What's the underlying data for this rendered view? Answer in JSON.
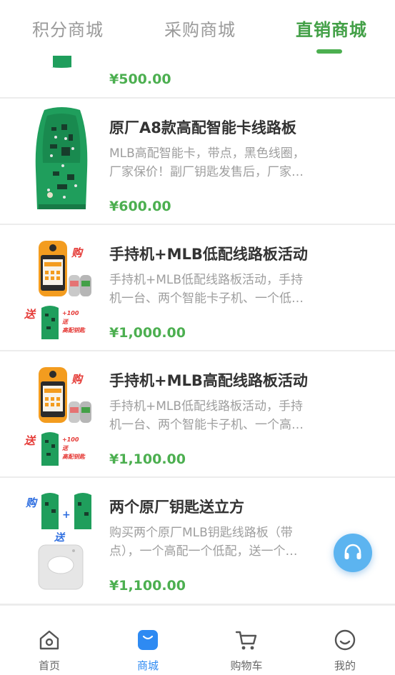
{
  "tabs": [
    {
      "label": "积分商城"
    },
    {
      "label": "采购商城"
    },
    {
      "label": "直销商城",
      "active": true
    }
  ],
  "products": [
    {
      "name": "",
      "desc": "",
      "price": "¥500.00",
      "image": "green-key-pcb-icon"
    },
    {
      "name": "原厂A8款高配智能卡线路板",
      "desc": "MLB高配智能卡，带点，黑色线圈，厂家保价！副厂钥匙发售后，厂家…",
      "price": "¥600.00",
      "image": "green-key-pcb-icon"
    },
    {
      "name": "手持机+MLB低配线路板活动",
      "desc": "手持机+MLB低配线路板活动，手持机一台、两个智能卡子机、一个低…",
      "price": "¥1,000.00",
      "image": "handheld-bundle-icon",
      "promo": {
        "buy": "购",
        "gift": "送",
        "extra_line1": "+100",
        "extra_line2": "送",
        "extra_line3": "高配钥匙"
      }
    },
    {
      "name": "手持机+MLB高配线路板活动",
      "desc": "手持机+MLB低配线路板活动，手持机一台、两个智能卡子机、一个高…",
      "price": "¥1,100.00",
      "image": "handheld-bundle-icon",
      "promo": {
        "buy": "购",
        "gift": "送",
        "extra_line1": "+100",
        "extra_line2": "送",
        "extra_line3": "高配钥匙"
      }
    },
    {
      "name": "两个原厂钥匙送立方",
      "desc": "购买两个原厂MLB钥匙线路板（带点），一个高配一个低配，送一个…",
      "price": "¥1,100.00",
      "image": "two-keys-cube-icon",
      "promo": {
        "buy": "购",
        "plus": "+",
        "gift": "送"
      }
    }
  ],
  "bottom_nav": [
    {
      "label": "首页",
      "icon": "home-icon"
    },
    {
      "label": "商城",
      "icon": "shop-bag-icon",
      "active": true
    },
    {
      "label": "购物车",
      "icon": "cart-icon"
    },
    {
      "label": "我的",
      "icon": "smile-icon"
    }
  ],
  "support_button": {
    "icon": "headset-icon"
  },
  "colors": {
    "accent_green": "#4caf50",
    "active_blue": "#2e8af2",
    "fab_blue": "#5cb4f0",
    "pcb_green": "#1f9e5c"
  }
}
